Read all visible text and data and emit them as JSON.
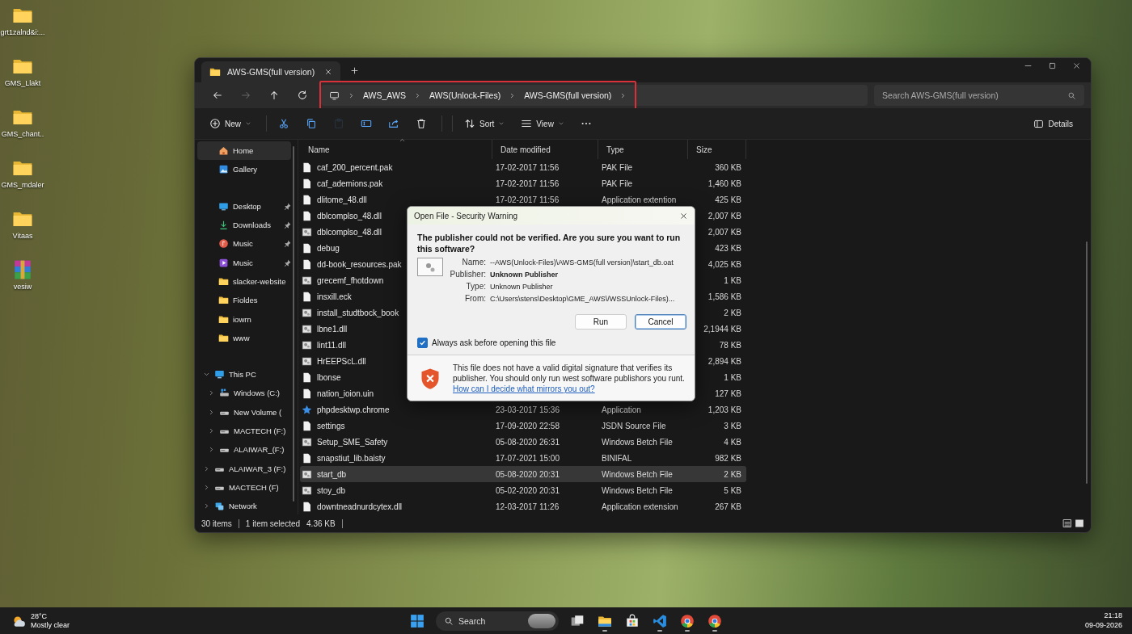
{
  "desktop_icons": [
    {
      "label": "grt1zalnd&i:...",
      "kind": "folder"
    },
    {
      "label": "GMS_Llakt",
      "kind": "folder"
    },
    {
      "label": "GMS_chant..",
      "kind": "folder"
    },
    {
      "label": "GMS_mdaler",
      "kind": "folder"
    },
    {
      "label": "Vitaas",
      "kind": "folder"
    },
    {
      "label": "vesiw",
      "kind": "archive"
    }
  ],
  "window": {
    "tab": {
      "title": "AWS-GMS(full version)"
    },
    "nav": [
      {
        "kind": "back",
        "disabled": false
      },
      {
        "kind": "forward",
        "disabled": true
      },
      {
        "kind": "up",
        "disabled": false
      },
      {
        "kind": "refresh",
        "disabled": false
      }
    ],
    "breadcrumb": [
      "AWS_AWS",
      "AWS(Unlock-Files)",
      "AWS-GMS(full version)"
    ],
    "search": {
      "placeholder": "Search AWS-GMS(full version)"
    },
    "toolbar": [
      {
        "kind": "new",
        "label": "New",
        "dropdown": true,
        "disabled": false
      },
      {
        "kind": "cut",
        "dropdown": false,
        "disabled": false
      },
      {
        "kind": "copy",
        "dropdown": false,
        "disabled": false
      },
      {
        "kind": "paste",
        "dropdown": false,
        "disabled": true
      },
      {
        "kind": "rename",
        "dropdown": false,
        "disabled": false
      },
      {
        "kind": "share",
        "dropdown": false,
        "disabled": false
      },
      {
        "kind": "delete",
        "dropdown": false,
        "disabled": false
      },
      {
        "kind": "sort",
        "label": "Sort",
        "dropdown": true,
        "disabled": false
      },
      {
        "kind": "view",
        "label": "View",
        "dropdown": true,
        "disabled": false
      },
      {
        "kind": "more",
        "dropdown": false,
        "disabled": false
      }
    ],
    "details_button": "Details",
    "sidebar": {
      "quick": [
        {
          "label": "Home",
          "kind": "home",
          "selected": true
        },
        {
          "label": "Gallery",
          "kind": "gallery",
          "selected": false
        }
      ],
      "pinned": [
        {
          "label": "Desktop",
          "kind": "desktop",
          "selected": false,
          "pinned": true
        },
        {
          "label": "Downloads",
          "kind": "downloads",
          "selected": false,
          "pinned": true
        },
        {
          "label": "Music",
          "kind": "music",
          "selected": false,
          "pinned": true
        },
        {
          "label": "Music",
          "kind": "video",
          "selected": false,
          "pinned": true
        },
        {
          "label": "slacker-website",
          "kind": "folder",
          "selected": false,
          "pinned": false
        },
        {
          "label": "Fioldes",
          "kind": "folder",
          "selected": false,
          "pinned": false
        },
        {
          "label": "iowrn",
          "kind": "folder",
          "selected": false,
          "pinned": false
        },
        {
          "label": "www",
          "kind": "folder",
          "selected": false,
          "pinned": false
        }
      ],
      "tree": [
        {
          "label": "This PC",
          "kind": "pc",
          "selected": false,
          "expanded": true,
          "children": [
            {
              "label": "Windows (C:)",
              "kind": "os-drive",
              "selected": false,
              "expanded": false
            },
            {
              "label": "New Volume (",
              "kind": "drive",
              "selected": false,
              "expanded": false
            },
            {
              "label": "MACTECH (F:)",
              "kind": "drive",
              "selected": false,
              "expanded": false
            },
            {
              "label": "ALAIWAR_(F:)",
              "kind": "drive",
              "selected": false,
              "expanded": false
            }
          ]
        },
        {
          "label": "ALAIWAR_3 (F:)",
          "kind": "drive",
          "selected": false,
          "expanded": false
        },
        {
          "label": "MACTECH (F)",
          "kind": "drive",
          "selected": false,
          "expanded": false
        },
        {
          "label": "Network",
          "kind": "network",
          "selected": false,
          "expanded": false
        }
      ]
    },
    "columns": [
      "Name",
      "Date modified",
      "Type",
      "Size"
    ],
    "rows": [
      {
        "name": "caf_200_percent.pak",
        "date": "17-02-2017 11:56",
        "type": "PAK File",
        "size": "360 KB",
        "kind": "file",
        "selected": false
      },
      {
        "name": "caf_ademions.pak",
        "date": "17-02-2017 11:56",
        "type": "PAK File",
        "size": "1,460 KB",
        "kind": "file",
        "selected": false
      },
      {
        "name": "dlitome_48.dll",
        "date": "17-02-2017 11:56",
        "type": "Application extention",
        "size": "425 KB",
        "kind": "file",
        "selected": false
      },
      {
        "name": "dblcomplso_48.dll",
        "size": "2,007 KB",
        "kind": "file",
        "selected": false
      },
      {
        "name": "dblcomplso_48.dll",
        "size": "2,007 KB",
        "kind": "app",
        "selected": false
      },
      {
        "name": "debug",
        "size": "423 KB",
        "kind": "file",
        "selected": false
      },
      {
        "name": "dd-book_resources.pak",
        "size": "4,025 KB",
        "kind": "file",
        "selected": false
      },
      {
        "name": "grecemf_fhotdown",
        "size": "1 KB",
        "kind": "app",
        "selected": false
      },
      {
        "name": "insxill.eck",
        "size": "1,586 KB",
        "kind": "file",
        "selected": false
      },
      {
        "name": "install_studtbock_book",
        "size": "2 KB",
        "kind": "app",
        "selected": false
      },
      {
        "name": "lbne1.dll",
        "size": "2,1944 KB",
        "kind": "app",
        "selected": false
      },
      {
        "name": "lint11.dll",
        "size": "78 KB",
        "kind": "app",
        "selected": false
      },
      {
        "name": "HrEEPScL.dll",
        "size": "2,894 KB",
        "kind": "app",
        "selected": false
      },
      {
        "name": "lbonse",
        "size": "1 KB",
        "kind": "file",
        "selected": false
      },
      {
        "name": "nation_ioion.uin",
        "size": "127 KB",
        "kind": "file",
        "selected": false
      },
      {
        "name": "phpdesktwp.chrome",
        "date": "23-03-2017 15:36",
        "type": "Application",
        "size": "1,203 KB",
        "kind": "star",
        "selected": false
      },
      {
        "name": "settings",
        "date": "17-09-2020 22:58",
        "type": "JSDN Source File",
        "size": "3 KB",
        "kind": "file",
        "selected": false
      },
      {
        "name": "Setup_SME_Safety",
        "date": "05-08-2020 26:31",
        "type": "Windows Betch File",
        "size": "4 KB",
        "kind": "app",
        "selected": false
      },
      {
        "name": "snapstiut_lib.baisty",
        "date": "17-07-2021 15:00",
        "type": "BINIFAL",
        "size": "982 KB",
        "kind": "file",
        "selected": false
      },
      {
        "name": "start_db",
        "date": "05-08-2020 20:31",
        "type": "Windows Betch File",
        "size": "2 KB",
        "kind": "app",
        "selected": true
      },
      {
        "name": "stoy_db",
        "date": "05-02-2020 20:31",
        "type": "Windows Betch File",
        "size": "5 KB",
        "kind": "app",
        "selected": false
      },
      {
        "name": "downtneadnurdcytex.dll",
        "date": "12-03-2017 11:26",
        "type": "Application extension",
        "size": "267 KB",
        "kind": "file",
        "selected": false
      }
    ],
    "status": {
      "count": "30 items",
      "selection": "1 item selected",
      "size": "4.36 KB"
    }
  },
  "dialog": {
    "title": "Open File - Security Warning",
    "heading": "The publisher could not be verified. Are you sure you want to run this software?",
    "fields": [
      {
        "label": "Name:",
        "value": "--AWS(Unlock-Files)\\AWS-GMS(full version)\\start_db.oat",
        "bold": false
      },
      {
        "label": "Publisher:",
        "value": "Unknown Publisher",
        "bold": true
      },
      {
        "label": "Type:",
        "value": "Unknown Publisher",
        "bold": false
      },
      {
        "label": "From:",
        "value": "C:\\Users\\stens\\Desktop\\GME_AWS\\/WSSUnlock-Files)...",
        "bold": false
      }
    ],
    "buttons": [
      {
        "label": "Run",
        "default": false
      },
      {
        "label": "Cancel",
        "default": true
      }
    ],
    "always_ask": {
      "label": "Always ask before opening this file",
      "checked": true
    },
    "notice": "This file does not have a valid digital signature that verifies its publisher. You should only run west software publishors you runt.",
    "link": "How can I decide what mirrors you out?"
  },
  "taskbar": {
    "weather": {
      "temp": "28°C",
      "condition": "Mostly clear"
    },
    "search": "Search",
    "apps": [
      {
        "kind": "start",
        "running": false
      },
      {
        "kind": "task-view",
        "running": false
      },
      {
        "kind": "explorer",
        "running": true
      },
      {
        "kind": "store",
        "running": false
      },
      {
        "kind": "code",
        "running": true
      },
      {
        "kind": "browser",
        "running": true
      },
      {
        "kind": "browser",
        "running": true
      }
    ],
    "clock": {
      "time": "21:18",
      "date": "09-09-2026"
    }
  }
}
